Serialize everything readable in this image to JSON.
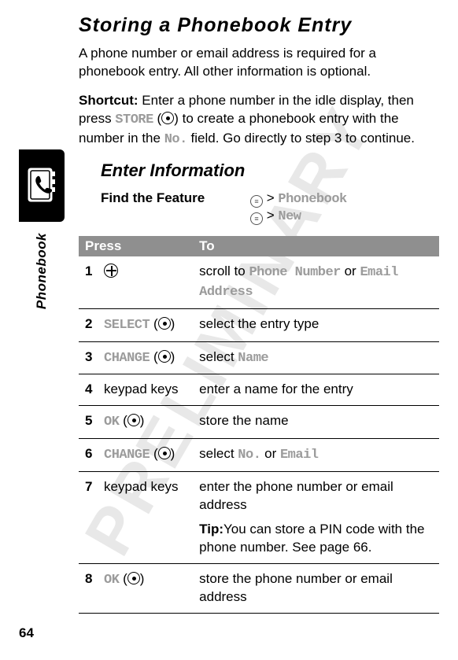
{
  "watermark": "PRELIMINARY",
  "sideLabel": "Phonebook",
  "pageNumber": "64",
  "title": "Storing a Phonebook Entry",
  "intro": "A phone number or email address is required for a phonebook entry. All other information is optional.",
  "shortcut": {
    "label": "Shortcut:",
    "text_before": " Enter a phone number in the idle display, then press ",
    "store": "STORE",
    "text_mid": " to create a phonebook entry with the number in the ",
    "no_field": "No.",
    "text_after": " field. Go directly to step 3 to continue."
  },
  "subheading": "Enter Information",
  "findFeature": {
    "label": "Find the Feature",
    "path1_item": "Phonebook",
    "path2_item": "New",
    "sep": ">"
  },
  "tableHeaders": {
    "press": "Press",
    "to": "To"
  },
  "steps": [
    {
      "num": "1",
      "pressType": "nav",
      "pressText": "",
      "to_before": "scroll to ",
      "to_ui1": "Phone Number",
      "to_mid": " or ",
      "to_ui2": "Email Address",
      "to_after": ""
    },
    {
      "num": "2",
      "pressType": "softkey",
      "pressText": "SELECT",
      "to_before": "select the entry type",
      "to_ui1": "",
      "to_mid": "",
      "to_ui2": "",
      "to_after": ""
    },
    {
      "num": "3",
      "pressType": "softkey",
      "pressText": "CHANGE",
      "to_before": "select ",
      "to_ui1": "Name",
      "to_mid": "",
      "to_ui2": "",
      "to_after": ""
    },
    {
      "num": "4",
      "pressType": "plain",
      "pressText": "keypad keys",
      "to_before": "enter a name for the entry",
      "to_ui1": "",
      "to_mid": "",
      "to_ui2": "",
      "to_after": ""
    },
    {
      "num": "5",
      "pressType": "softkey",
      "pressText": "OK",
      "to_before": "store the name",
      "to_ui1": "",
      "to_mid": "",
      "to_ui2": "",
      "to_after": ""
    },
    {
      "num": "6",
      "pressType": "softkey",
      "pressText": "CHANGE",
      "to_before": "select ",
      "to_ui1": "No.",
      "to_mid": " or ",
      "to_ui2": "Email",
      "to_after": ""
    },
    {
      "num": "7",
      "pressType": "plain",
      "pressText": "keypad keys",
      "to_before": "enter the phone number or email address",
      "to_ui1": "",
      "to_mid": "",
      "to_ui2": "",
      "to_after": "",
      "tipLabel": "Tip:",
      "tipText": "You can store a PIN code with the phone number. See page 66."
    },
    {
      "num": "8",
      "pressType": "softkey",
      "pressText": "OK",
      "to_before": "store the phone number or email address",
      "to_ui1": "",
      "to_mid": "",
      "to_ui2": "",
      "to_after": ""
    }
  ]
}
